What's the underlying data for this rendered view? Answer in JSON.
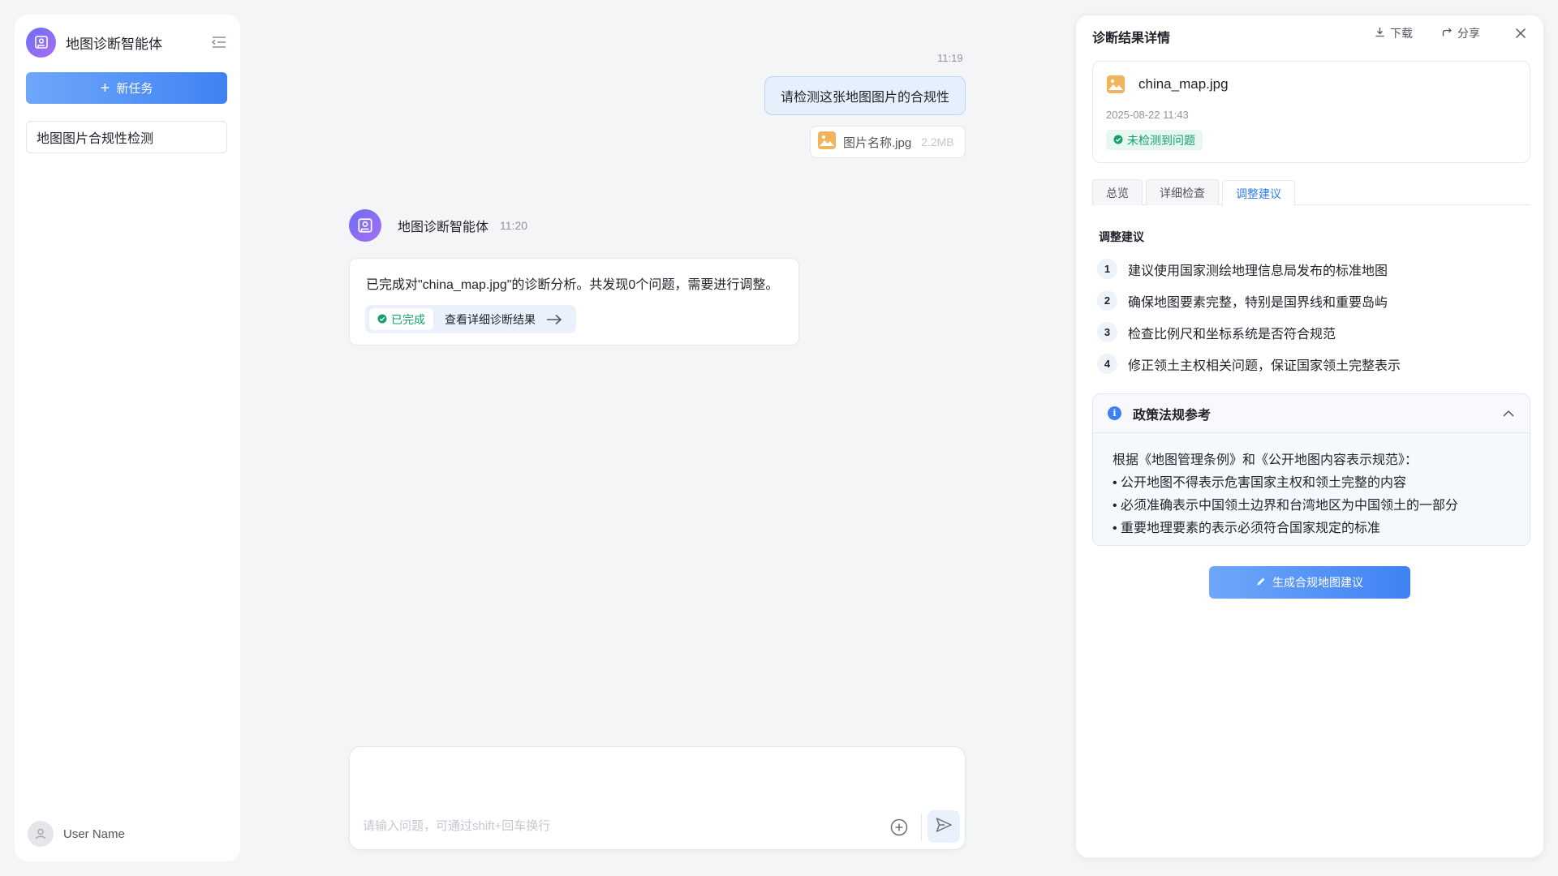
{
  "sidebar": {
    "title": "地图诊断智能体",
    "new_task_label": "新任务",
    "tasks": [
      {
        "label": "地图图片合规性检测"
      }
    ],
    "user_name": "User Name"
  },
  "chat": {
    "user_message": {
      "time": "11:19",
      "text": "请检测这张地图图片的合规性",
      "attachment": {
        "name": "图片名称.jpg",
        "size": "2.2MB"
      }
    },
    "agent_message": {
      "name": "地图诊断智能体",
      "time": "11:20",
      "text": "已完成对\"china_map.jpg\"的诊断分析。共发现0个问题，需要进行调整。",
      "status": "已完成",
      "link_label": "查看详细诊断结果"
    },
    "composer": {
      "placeholder": "请输入问题，可通过shift+回车换行"
    }
  },
  "panel": {
    "title": "诊断结果详情",
    "download_label": "下载",
    "share_label": "分享",
    "file": {
      "name": "china_map.jpg",
      "date": "2025-08-22 11:43",
      "status": "未检测到问题"
    },
    "tabs": [
      {
        "label": "总览",
        "active": false
      },
      {
        "label": "详细检查",
        "active": false
      },
      {
        "label": "调整建议",
        "active": true
      }
    ],
    "suggestions_title": "调整建议",
    "suggestions": [
      {
        "num": "1",
        "text": "建议使用国家测绘地理信息局发布的标准地图"
      },
      {
        "num": "2",
        "text": "确保地图要素完整，特别是国界线和重要岛屿"
      },
      {
        "num": "3",
        "text": "检查比例尺和坐标系统是否符合规范"
      },
      {
        "num": "4",
        "text": "修正领土主权相关问题，保证国家领土完整表示"
      }
    ],
    "policy": {
      "title": "政策法规参考",
      "intro": "根据《地图管理条例》和《公开地图内容表示规范》：",
      "items": [
        "公开地图不得表示危害国家主权和领土完整的内容",
        "必须准确表示中国领土边界和台湾地区为中国领土的一部分",
        "重要地理要素的表示必须符合国家规定的标准"
      ]
    },
    "generate_label": "生成合规地图建议"
  },
  "colors": {
    "accent": "#3f82f2",
    "success": "#14a06b",
    "brand_gradient_start": "#6e6df6",
    "brand_gradient_end": "#a66ef2"
  },
  "icons": {
    "logo": "map-pin-image-icon",
    "collapse": "menu-collapse-icon",
    "file": "image-file-icon",
    "check": "check-circle-icon",
    "arrow": "arrow-right-icon",
    "attach": "plus-circle-icon",
    "send": "send-icon",
    "download": "download-icon",
    "share": "share-icon",
    "close": "close-icon",
    "info": "info-icon",
    "chevron": "chevron-up-icon",
    "edit": "pencil-icon",
    "user": "user-icon"
  }
}
